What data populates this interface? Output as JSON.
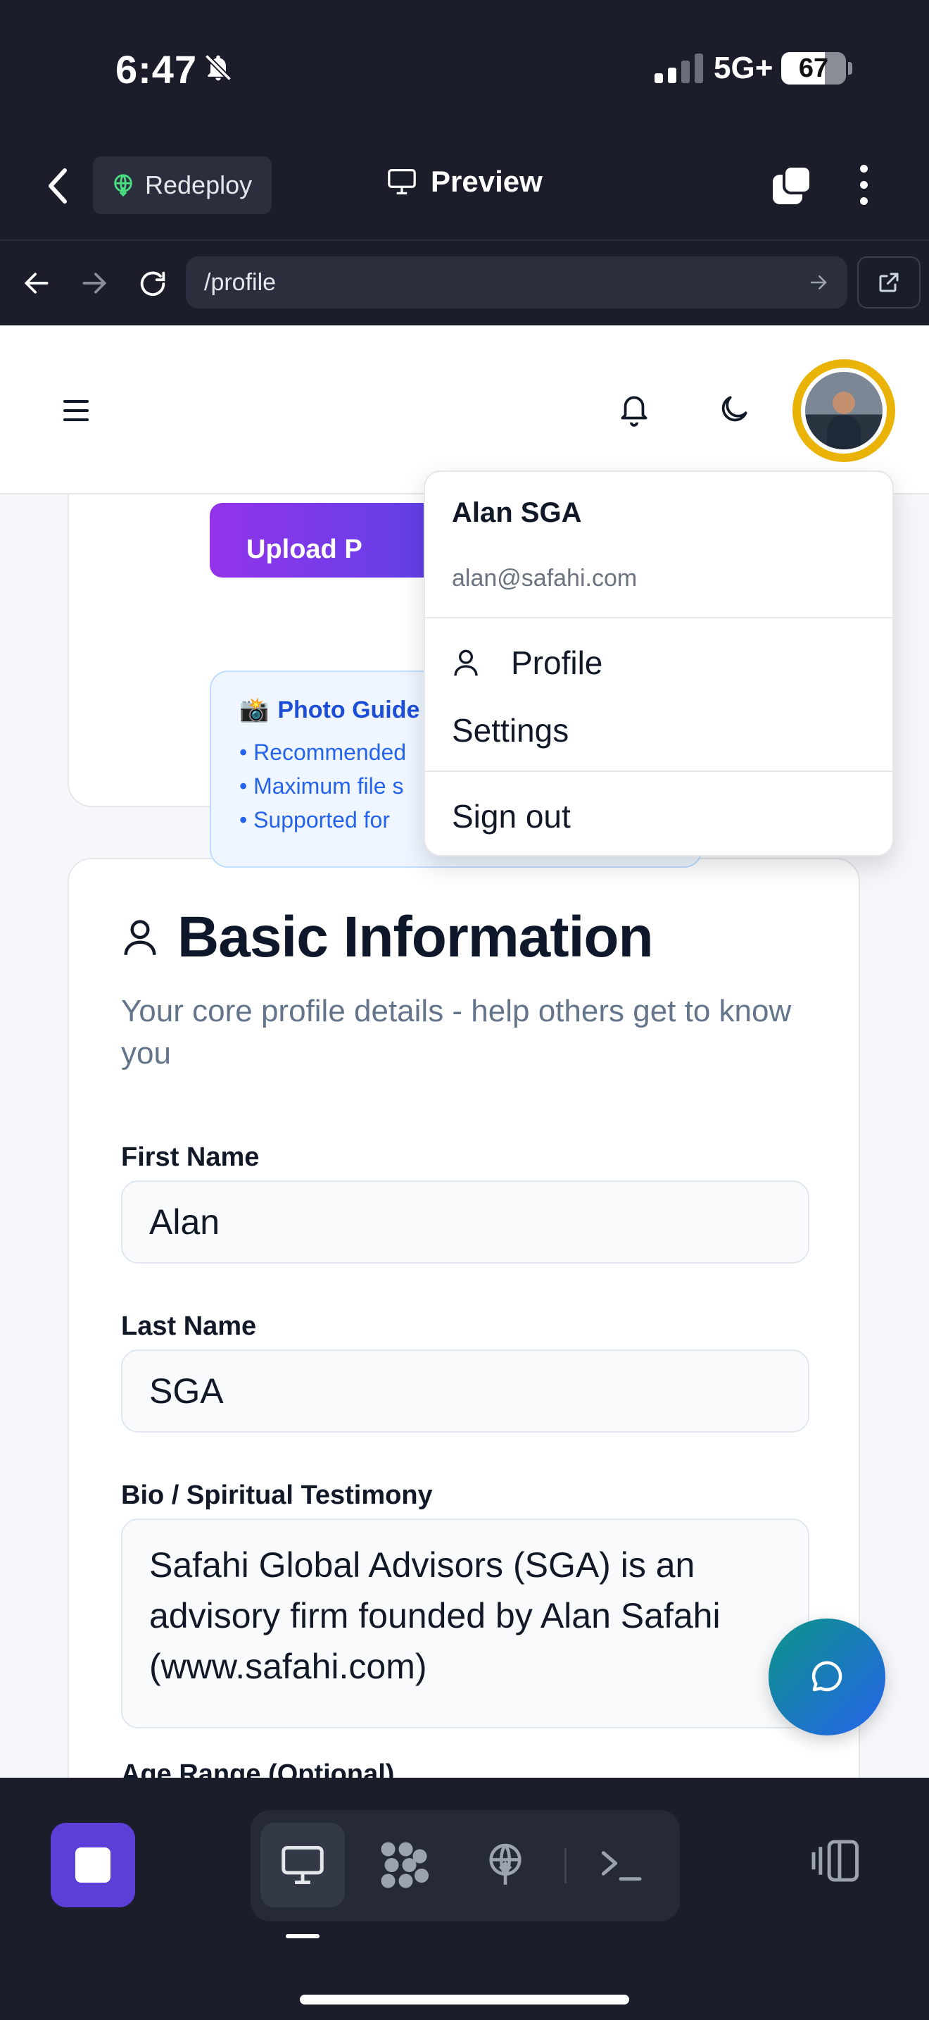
{
  "status_bar": {
    "time": "6:47",
    "network": "5G+",
    "battery": "67",
    "battery_level_fraction": 0.67,
    "icons": [
      "bell-slash-icon",
      "signal-icon",
      "battery-icon"
    ]
  },
  "chrome": {
    "redeploy_label": "Redeploy",
    "preview_label": "Preview",
    "url": "/profile"
  },
  "profile_menu": {
    "name": "Alan SGA",
    "email": "alan@safahi.com",
    "profile_label": "Profile",
    "settings_label": "Settings",
    "signout_label": "Sign out"
  },
  "photo_card": {
    "upload_label": "Upload P",
    "guide_title": "Photo Guide",
    "guide_items": [
      "• Recommended",
      "• Maximum file s",
      "• Supported for"
    ]
  },
  "basic_info": {
    "title": "Basic Information",
    "subtitle": "Your core profile details - help others get to know you",
    "first_name_label": "First Name",
    "first_name_value": "Alan",
    "last_name_label": "Last Name",
    "last_name_value": "SGA",
    "bio_label": "Bio / Spiritual Testimony",
    "bio_value": "Safahi Global Advisors (SGA) is an advisory firm founded by Alan Safahi (www.safahi.com)",
    "age_range_label": "Age Range (Optional)"
  },
  "colors": {
    "chrome_bg": "#1b1e2a",
    "accent_purple": "#5b3fd6",
    "avatar_ring": "#eab308",
    "link_blue": "#2563eb"
  }
}
